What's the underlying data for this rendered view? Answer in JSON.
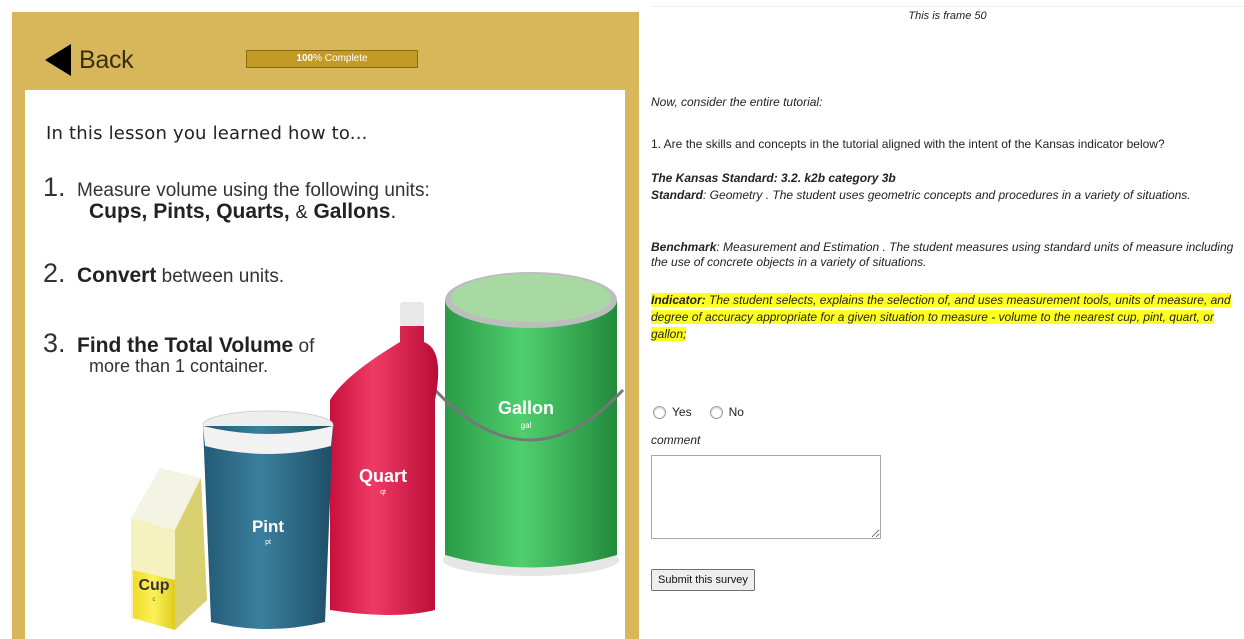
{
  "lesson": {
    "back_label": "Back",
    "progress": {
      "percent": 100,
      "value_text": "100",
      "suffix": "% Complete"
    },
    "intro": "In this lesson you learned how to...",
    "items": [
      {
        "number": "1.",
        "line1": "Measure volume using the following units:",
        "units": [
          "Cups,",
          "Pints,",
          "Quarts,",
          "&",
          "Gallons",
          "."
        ]
      },
      {
        "number": "2.",
        "bold": "Convert",
        "rest": " between units."
      },
      {
        "number": "3.",
        "bold": "Find the Total Volume",
        "rest": " of",
        "line2": "more than 1 container."
      }
    ],
    "containers": [
      {
        "name": "Cup",
        "abbr": "c",
        "color": "#f2e33a"
      },
      {
        "name": "Pint",
        "abbr": "pt",
        "color": "#2e6a86"
      },
      {
        "name": "Quart",
        "abbr": "qt",
        "color": "#e32050"
      },
      {
        "name": "Gallon",
        "abbr": "gal",
        "color": "#3bb35a"
      }
    ],
    "colors": {
      "frame": "#d7b75a",
      "progress": "#c49a27"
    }
  },
  "survey": {
    "frame_label": "This is frame 50",
    "intro": "Now, consider the entire tutorial:",
    "question": "1. Are the skills and concepts in the tutorial aligned with the intent of the Kansas indicator below?",
    "standard_title": "The Kansas Standard: 3.2. k2b category 3b",
    "standard_label": "Standard",
    "standard_text": ": Geometry . The student uses geometric concepts and procedures in a variety of situations.",
    "benchmark_label": "Benchmark",
    "benchmark_text": ": Measurement and Estimation . The student measures using standard units of measure including the use of concrete objects in a variety of situations.",
    "indicator_label": "Indicator:",
    "indicator_text": " The student selects, explains the selection of, and uses measurement tools, units of measure, and degree of accuracy appropriate for a given situation to measure - volume to the nearest cup, pint, quart, or gallon;",
    "options": [
      "Yes",
      "No"
    ],
    "comment_label": "comment",
    "comment_value": "",
    "submit_label": "Submit this survey",
    "highlight_color": "#ffff22"
  }
}
